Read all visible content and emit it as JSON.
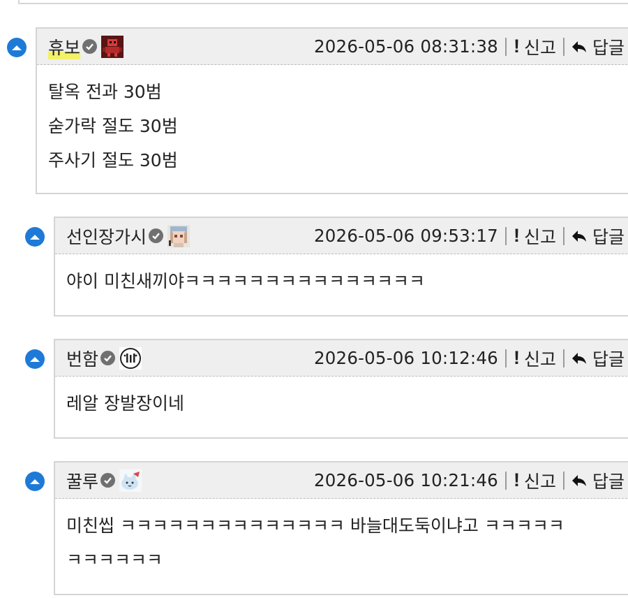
{
  "comments": [
    {
      "nickname": "휴보",
      "avatar_icon": "robot-avatar",
      "date": "2026-05-06 08:31:38",
      "report_label": "신고",
      "reply_label": "답글",
      "lines": [
        "탈옥 전과 30범",
        "숟가락 절도 30범",
        "주사기 절도 30범"
      ]
    },
    {
      "nickname": "선인장가시",
      "avatar_icon": "anime-character-avatar",
      "date": "2026-05-06 09:53:17",
      "report_label": "신고",
      "reply_label": "답글",
      "lines": [
        "야이 미친새끼야ㅋㅋㅋㅋㅋㅋㅋㅋㅋㅋㅋㅋㅋㅋㅋ"
      ]
    },
    {
      "nickname": "번함",
      "avatar_icon": "circle-logo-avatar",
      "date": "2026-05-06 10:12:46",
      "report_label": "신고",
      "reply_label": "답글",
      "lines": [
        "레알 장발장이네"
      ]
    },
    {
      "nickname": "꿀루",
      "avatar_icon": "cartoon-cat-avatar",
      "date": "2026-05-06 10:21:46",
      "report_label": "신고",
      "reply_label": "답글",
      "lines": [
        "미친씹 ㅋㅋㅋㅋㅋㅋㅋㅋㅋㅋㅋㅋㅋㅋ 바늘대도둑이냐고 ㅋㅋㅋㅋㅋ",
        "ㅋㅋㅋㅋㅋㅋ"
      ]
    }
  ],
  "colors": {
    "collapse_button": "#1e7ad6",
    "header_bg": "#efefef",
    "border": "#d4d4d4",
    "nickname_highlight": "#f3f06a",
    "verified_badge": "#707070"
  }
}
